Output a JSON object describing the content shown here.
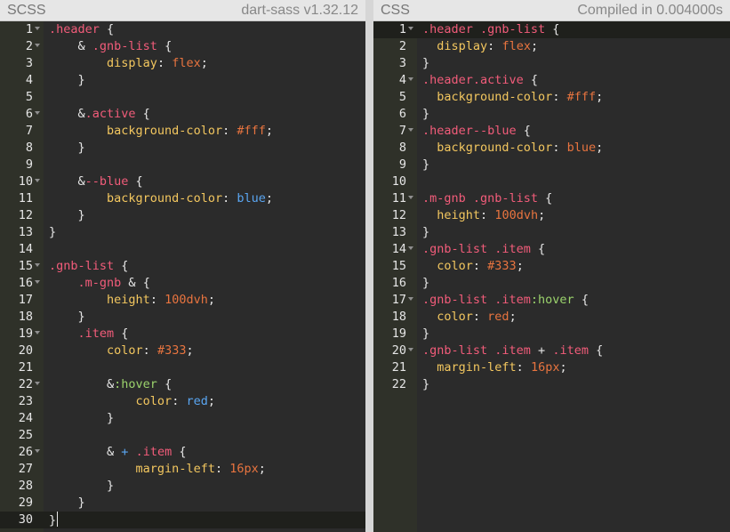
{
  "left": {
    "title": "SCSS",
    "meta": "dart-sass v1.32.12",
    "lines": [
      {
        "n": "1",
        "fold": true,
        "tokens": [
          [
            "sel",
            ".header"
          ],
          [
            "brace",
            " {"
          ]
        ]
      },
      {
        "n": "2",
        "fold": true,
        "tokens": [
          [
            "amp",
            "    & "
          ],
          [
            "sel",
            ".gnb-list"
          ],
          [
            "brace",
            " {"
          ]
        ]
      },
      {
        "n": "3",
        "fold": false,
        "tokens": [
          [
            "amp",
            "        "
          ],
          [
            "prop",
            "display"
          ],
          [
            "brace",
            ": "
          ],
          [
            "val",
            "flex"
          ],
          [
            "brace",
            ";"
          ]
        ]
      },
      {
        "n": "4",
        "fold": false,
        "tokens": [
          [
            "brace",
            "    }"
          ]
        ]
      },
      {
        "n": "5",
        "fold": false,
        "tokens": []
      },
      {
        "n": "6",
        "fold": true,
        "tokens": [
          [
            "amp",
            "    &"
          ],
          [
            "sel",
            ".active"
          ],
          [
            "brace",
            " {"
          ]
        ]
      },
      {
        "n": "7",
        "fold": false,
        "tokens": [
          [
            "amp",
            "        "
          ],
          [
            "prop",
            "background-color"
          ],
          [
            "brace",
            ": "
          ],
          [
            "val",
            "#fff"
          ],
          [
            "brace",
            ";"
          ]
        ]
      },
      {
        "n": "8",
        "fold": false,
        "tokens": [
          [
            "brace",
            "    }"
          ]
        ]
      },
      {
        "n": "9",
        "fold": false,
        "tokens": []
      },
      {
        "n": "10",
        "fold": true,
        "tokens": [
          [
            "amp",
            "    &"
          ],
          [
            "sel",
            "--blue"
          ],
          [
            "brace",
            " {"
          ]
        ]
      },
      {
        "n": "11",
        "fold": false,
        "tokens": [
          [
            "amp",
            "        "
          ],
          [
            "prop",
            "background-color"
          ],
          [
            "brace",
            ": "
          ],
          [
            "kw",
            "blue"
          ],
          [
            "brace",
            ";"
          ]
        ]
      },
      {
        "n": "12",
        "fold": false,
        "tokens": [
          [
            "brace",
            "    }"
          ]
        ]
      },
      {
        "n": "13",
        "fold": false,
        "tokens": [
          [
            "brace",
            "}"
          ]
        ]
      },
      {
        "n": "14",
        "fold": false,
        "tokens": []
      },
      {
        "n": "15",
        "fold": true,
        "tokens": [
          [
            "sel",
            ".gnb-list"
          ],
          [
            "brace",
            " {"
          ]
        ]
      },
      {
        "n": "16",
        "fold": true,
        "tokens": [
          [
            "amp",
            "    "
          ],
          [
            "sel",
            ".m-gnb"
          ],
          [
            "amp",
            " & "
          ],
          [
            "brace",
            "{"
          ]
        ]
      },
      {
        "n": "17",
        "fold": false,
        "tokens": [
          [
            "amp",
            "        "
          ],
          [
            "prop",
            "height"
          ],
          [
            "brace",
            ": "
          ],
          [
            "num",
            "100"
          ],
          [
            "val",
            "dvh"
          ],
          [
            "brace",
            ";"
          ]
        ]
      },
      {
        "n": "18",
        "fold": false,
        "tokens": [
          [
            "brace",
            "    }"
          ]
        ]
      },
      {
        "n": "19",
        "fold": true,
        "tokens": [
          [
            "amp",
            "    "
          ],
          [
            "sel",
            ".item"
          ],
          [
            "brace",
            " {"
          ]
        ]
      },
      {
        "n": "20",
        "fold": false,
        "tokens": [
          [
            "amp",
            "        "
          ],
          [
            "prop",
            "color"
          ],
          [
            "brace",
            ": "
          ],
          [
            "val",
            "#333"
          ],
          [
            "brace",
            ";"
          ]
        ]
      },
      {
        "n": "21",
        "fold": false,
        "tokens": []
      },
      {
        "n": "22",
        "fold": true,
        "tokens": [
          [
            "amp",
            "        &"
          ],
          [
            "pseudo",
            ":hover"
          ],
          [
            "brace",
            " {"
          ]
        ]
      },
      {
        "n": "23",
        "fold": false,
        "tokens": [
          [
            "amp",
            "            "
          ],
          [
            "prop",
            "color"
          ],
          [
            "brace",
            ": "
          ],
          [
            "kw",
            "red"
          ],
          [
            "brace",
            ";"
          ]
        ]
      },
      {
        "n": "24",
        "fold": false,
        "tokens": [
          [
            "brace",
            "        }"
          ]
        ]
      },
      {
        "n": "25",
        "fold": false,
        "tokens": []
      },
      {
        "n": "26",
        "fold": true,
        "tokens": [
          [
            "amp",
            "        & "
          ],
          [
            "plus",
            "+"
          ],
          [
            "amp",
            " "
          ],
          [
            "sel",
            ".item"
          ],
          [
            "brace",
            " {"
          ]
        ]
      },
      {
        "n": "27",
        "fold": false,
        "tokens": [
          [
            "amp",
            "            "
          ],
          [
            "prop",
            "margin-left"
          ],
          [
            "brace",
            ": "
          ],
          [
            "num",
            "16"
          ],
          [
            "val",
            "px"
          ],
          [
            "brace",
            ";"
          ]
        ]
      },
      {
        "n": "28",
        "fold": false,
        "tokens": [
          [
            "brace",
            "        }"
          ]
        ]
      },
      {
        "n": "29",
        "fold": false,
        "tokens": [
          [
            "brace",
            "    }"
          ]
        ]
      },
      {
        "n": "30",
        "fold": false,
        "active": true,
        "tokens": [
          [
            "brace",
            "}"
          ]
        ]
      }
    ]
  },
  "right": {
    "title": "CSS",
    "meta": "Compiled in 0.004000s",
    "lines": [
      {
        "n": "1",
        "fold": true,
        "active": true,
        "tokens": [
          [
            "sel",
            ".header .gnb-list"
          ],
          [
            "brace",
            " {"
          ]
        ]
      },
      {
        "n": "2",
        "fold": false,
        "tokens": [
          [
            "amp",
            "  "
          ],
          [
            "prop",
            "display"
          ],
          [
            "brace",
            ": "
          ],
          [
            "val",
            "flex"
          ],
          [
            "brace",
            ";"
          ]
        ]
      },
      {
        "n": "3",
        "fold": false,
        "tokens": [
          [
            "brace",
            "}"
          ]
        ]
      },
      {
        "n": "4",
        "fold": true,
        "tokens": [
          [
            "sel",
            ".header.active"
          ],
          [
            "brace",
            " {"
          ]
        ]
      },
      {
        "n": "5",
        "fold": false,
        "tokens": [
          [
            "amp",
            "  "
          ],
          [
            "prop",
            "background-color"
          ],
          [
            "brace",
            ": "
          ],
          [
            "val",
            "#fff"
          ],
          [
            "brace",
            ";"
          ]
        ]
      },
      {
        "n": "6",
        "fold": false,
        "tokens": [
          [
            "brace",
            "}"
          ]
        ]
      },
      {
        "n": "7",
        "fold": true,
        "tokens": [
          [
            "sel",
            ".header--blue"
          ],
          [
            "brace",
            " {"
          ]
        ]
      },
      {
        "n": "8",
        "fold": false,
        "tokens": [
          [
            "amp",
            "  "
          ],
          [
            "prop",
            "background-color"
          ],
          [
            "brace",
            ": "
          ],
          [
            "val",
            "blue"
          ],
          [
            "brace",
            ";"
          ]
        ]
      },
      {
        "n": "9",
        "fold": false,
        "tokens": [
          [
            "brace",
            "}"
          ]
        ]
      },
      {
        "n": "10",
        "fold": false,
        "tokens": []
      },
      {
        "n": "11",
        "fold": true,
        "tokens": [
          [
            "sel",
            ".m-gnb .gnb-list"
          ],
          [
            "brace",
            " {"
          ]
        ]
      },
      {
        "n": "12",
        "fold": false,
        "tokens": [
          [
            "amp",
            "  "
          ],
          [
            "prop",
            "height"
          ],
          [
            "brace",
            ": "
          ],
          [
            "num",
            "100"
          ],
          [
            "val",
            "dvh"
          ],
          [
            "brace",
            ";"
          ]
        ]
      },
      {
        "n": "13",
        "fold": false,
        "tokens": [
          [
            "brace",
            "}"
          ]
        ]
      },
      {
        "n": "14",
        "fold": true,
        "tokens": [
          [
            "sel",
            ".gnb-list .item"
          ],
          [
            "brace",
            " {"
          ]
        ]
      },
      {
        "n": "15",
        "fold": false,
        "tokens": [
          [
            "amp",
            "  "
          ],
          [
            "prop",
            "color"
          ],
          [
            "brace",
            ": "
          ],
          [
            "val",
            "#333"
          ],
          [
            "brace",
            ";"
          ]
        ]
      },
      {
        "n": "16",
        "fold": false,
        "tokens": [
          [
            "brace",
            "}"
          ]
        ]
      },
      {
        "n": "17",
        "fold": true,
        "tokens": [
          [
            "sel",
            ".gnb-list .item"
          ],
          [
            "pseudo",
            ":hover"
          ],
          [
            "brace",
            " {"
          ]
        ]
      },
      {
        "n": "18",
        "fold": false,
        "tokens": [
          [
            "amp",
            "  "
          ],
          [
            "prop",
            "color"
          ],
          [
            "brace",
            ": "
          ],
          [
            "val",
            "red"
          ],
          [
            "brace",
            ";"
          ]
        ]
      },
      {
        "n": "19",
        "fold": false,
        "tokens": [
          [
            "brace",
            "}"
          ]
        ]
      },
      {
        "n": "20",
        "fold": true,
        "tokens": [
          [
            "sel",
            ".gnb-list .item"
          ],
          [
            "amp",
            " + "
          ],
          [
            "sel",
            ".item"
          ],
          [
            "brace",
            " {"
          ]
        ]
      },
      {
        "n": "21",
        "fold": false,
        "tokens": [
          [
            "amp",
            "  "
          ],
          [
            "prop",
            "margin-left"
          ],
          [
            "brace",
            ": "
          ],
          [
            "num",
            "16"
          ],
          [
            "val",
            "px"
          ],
          [
            "brace",
            ";"
          ]
        ]
      },
      {
        "n": "22",
        "fold": false,
        "tokens": [
          [
            "brace",
            "}"
          ]
        ]
      }
    ]
  },
  "colors": {
    "editor_bg": "#2b2b2b",
    "gutter_bg": "#2f3129",
    "header_bg": "#e6e6e6",
    "selector": "#f25c7a",
    "property": "#f3c75f",
    "value": "#e8743f",
    "keyword": "#5aa6f2",
    "pseudo": "#9bd36c"
  }
}
